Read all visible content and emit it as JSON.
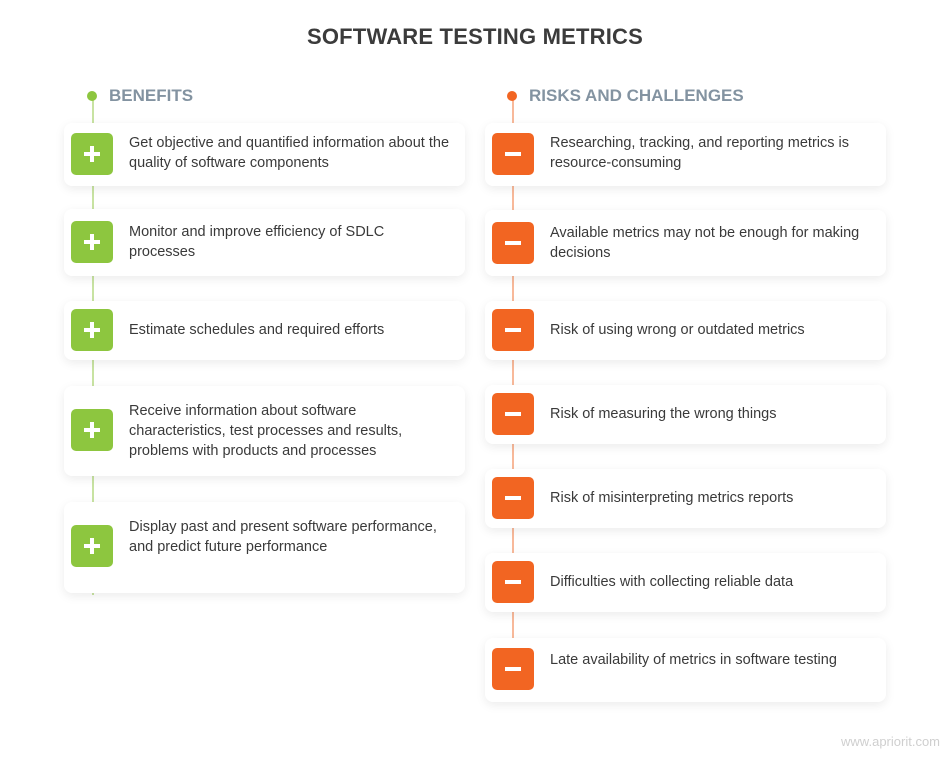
{
  "title": "SOFTWARE TESTING METRICS",
  "colors": {
    "green": "#8dc63f",
    "orange": "#f26522",
    "heading": "#8393a1"
  },
  "benefits": {
    "heading": "BENEFITS",
    "icon": "plus-icon",
    "items": [
      "Get objective and quantified information about the quality of software components",
      "Monitor and improve efficiency of SDLC processes",
      "Estimate schedules and required efforts",
      "Receive information about software characteristics, test processes and results, problems with products and processes",
      "Display past and present software performance, and predict future performance"
    ]
  },
  "risks": {
    "heading": "RISKS AND CHALLENGES",
    "icon": "minus-icon",
    "items": [
      "Researching, tracking, and reporting metrics is resource-consuming",
      "Available metrics may not be enough for making decisions",
      "Risk of using wrong or outdated metrics",
      "Risk of measuring the wrong things",
      "Risk of misinterpreting metrics reports",
      "Difficulties with collecting reliable data",
      "Late availability of metrics in software testing"
    ]
  },
  "watermark": "www.apriorit.com"
}
